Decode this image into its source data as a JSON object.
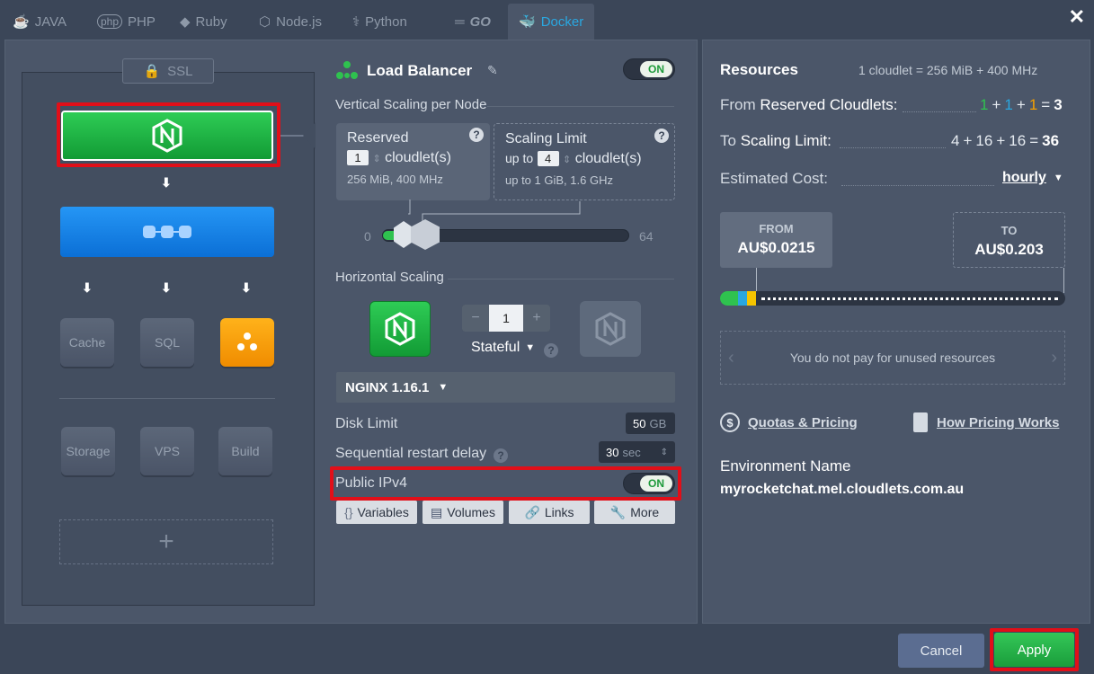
{
  "tabs": [
    {
      "label": "JAVA",
      "icon": "java-icon"
    },
    {
      "label": "PHP",
      "icon": "php-icon"
    },
    {
      "label": "Ruby",
      "icon": "ruby-icon"
    },
    {
      "label": "Node.js",
      "icon": "nodejs-icon"
    },
    {
      "label": "Python",
      "icon": "python-icon"
    },
    {
      "label": "GO",
      "icon": "go-icon"
    },
    {
      "label": "Docker",
      "icon": "docker-icon"
    }
  ],
  "topology": {
    "ssl_label": "SSL",
    "tiles": [
      "Cache",
      "SQL",
      "Storage",
      "VPS",
      "Build"
    ],
    "add_label": "+"
  },
  "node": {
    "title": "Load Balancer",
    "toggle": "ON",
    "vertical_label": "Vertical Scaling per Node",
    "reserved": {
      "title": "Reserved",
      "value": "1",
      "unit": "cloudlet(s)",
      "spec": "256 MiB, 400 MHz"
    },
    "limit": {
      "title": "Scaling Limit",
      "prefix": "up to",
      "value": "4",
      "unit": "cloudlet(s)",
      "spec_prefix": "up to",
      "spec": "1 GiB, 1.6 GHz"
    },
    "slider_min": "0",
    "slider_max": "64",
    "horizontal_label": "Horizontal Scaling",
    "count": "1",
    "minus": "−",
    "plus": "+",
    "mode": "Stateful",
    "version": "NGINX 1.16.1",
    "disk_label": "Disk Limit",
    "disk_value": "50",
    "disk_unit": "GB",
    "restart_label": "Sequential restart delay",
    "restart_value": "30",
    "restart_unit": "sec",
    "ipv4_label": "Public IPv4",
    "ipv4_toggle": "ON",
    "actions": [
      "Variables",
      "Volumes",
      "Links",
      "More"
    ]
  },
  "resources": {
    "title": "Resources",
    "cloudlet_def": "1 cloudlet = 256 MiB + 400 MHz",
    "reserved_prefix": "From",
    "reserved_label": "Reserved Cloudlets:",
    "reserved_terms": [
      "1",
      "+",
      "1",
      "+",
      "1",
      "=",
      "3"
    ],
    "limit_prefix": "To",
    "limit_label": "Scaling Limit:",
    "limit_terms": [
      "4",
      "+",
      "16",
      "+",
      "16",
      "=",
      "36"
    ],
    "cost_label": "Estimated Cost:",
    "cost_period": "hourly",
    "from_label": "FROM",
    "from_value": "AU$0.0215",
    "to_label": "TO",
    "to_value": "AU$0.203",
    "notice": "You do not pay for unused resources",
    "quotas_link": "Quotas & Pricing",
    "how_link": "How Pricing Works",
    "env_label": "Environment Name",
    "env_value": "myrocketchat.mel.cloudlets.com.au"
  },
  "footer": {
    "cancel": "Cancel",
    "apply": "Apply"
  },
  "colors": {
    "green": "#1fae3f",
    "blue": "#1a82e8",
    "orange": "#f5a000",
    "accent": "#2aa7e0",
    "highlight": "#e10f19"
  }
}
